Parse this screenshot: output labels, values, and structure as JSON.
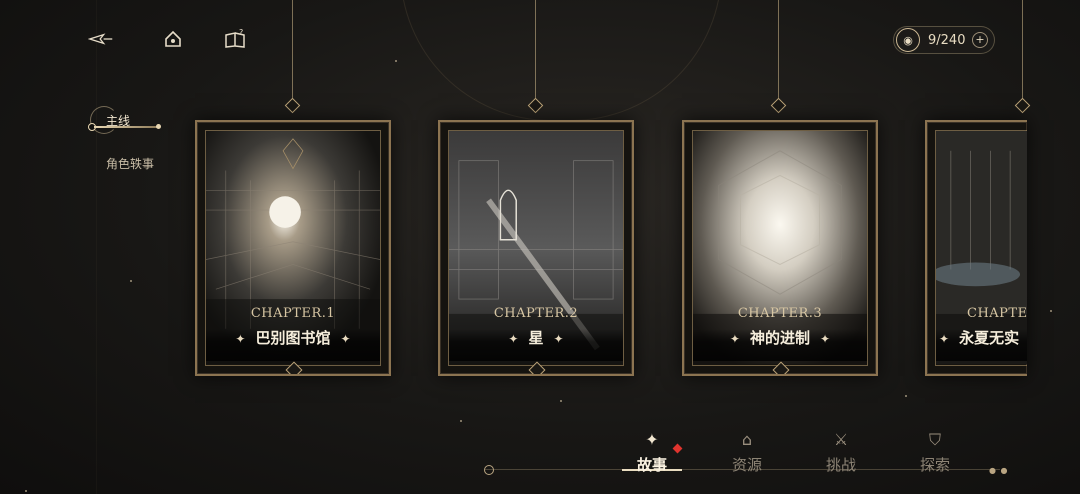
{
  "top_bar": {
    "back_icon": "back-arrow-icon",
    "home_icon": "home-icon",
    "help_icon": "help-book-icon",
    "currency": {
      "icon": "ticket-coin-icon",
      "value": "9/240",
      "add_icon": "plus-icon"
    }
  },
  "left_nav": {
    "main": "主线",
    "sub": "角色轶事"
  },
  "chapters": [
    {
      "chapter": "CHAPTER.1",
      "name": "巴别图书馆"
    },
    {
      "chapter": "CHAPTER.2",
      "name": "星"
    },
    {
      "chapter": "CHAPTER.3",
      "name": "神的进制"
    },
    {
      "chapter": "CHAPTE",
      "name": "永夏无实"
    }
  ],
  "bottom_tabs": [
    {
      "label": "故事",
      "icon": "story-star-icon",
      "active": true,
      "badge": true
    },
    {
      "label": "资源",
      "icon": "resource-icon",
      "active": false
    },
    {
      "label": "挑战",
      "icon": "challenge-swords-icon",
      "active": false
    },
    {
      "label": "探索",
      "icon": "explore-icon",
      "active": false
    }
  ],
  "colors": {
    "accent_gold": "#bfa67a",
    "badge_red": "#e0342e",
    "background": "#181715"
  }
}
